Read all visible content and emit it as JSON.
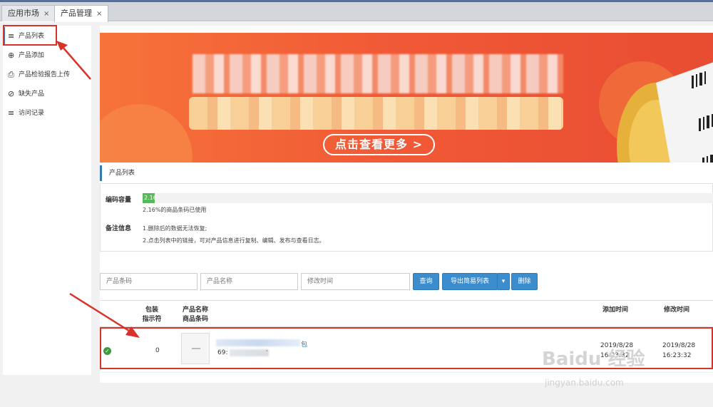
{
  "tabs": [
    {
      "label": "应用市场",
      "close": "×"
    },
    {
      "label": "产品管理",
      "close": "×"
    }
  ],
  "sidebar": {
    "items": [
      {
        "icon": "list-icon",
        "glyph": "≡",
        "label": "产品列表"
      },
      {
        "icon": "add-doc-icon",
        "glyph": "⊕",
        "label": "产品添加"
      },
      {
        "icon": "upload-doc-icon",
        "glyph": "⎙",
        "label": "产品检验报告上传"
      },
      {
        "icon": "missing-doc-icon",
        "glyph": "⊘",
        "label": "缺失产品"
      },
      {
        "icon": "list-icon",
        "glyph": "≡",
        "label": "访问记录"
      }
    ]
  },
  "banner": {
    "more_label": "点击查看更多 >"
  },
  "panel": {
    "title": "产品列表"
  },
  "info": {
    "capacity_label": "编码容量",
    "capacity_value": "2.16",
    "capacity_percent": 2.16,
    "capacity_note": "2.16%的商品条码已使用",
    "remark_label": "备注信息",
    "remark_1": "1.删除后的数据无法恢复;",
    "remark_2": "2.点击列表中的链接，可对产品信息进行复制、编辑、发布与查看日志。"
  },
  "filters": {
    "barcode_placeholder": "产品条码",
    "name_placeholder": "产品名称",
    "time_placeholder": "修改时间",
    "query_label": "查询",
    "export_label": "导出简易列表",
    "export_caret": "▾",
    "delete_label": "删除"
  },
  "table": {
    "headers": {
      "pack_1": "包装",
      "pack_2": "指示符",
      "name_1": "产品名称",
      "name_2": "商品条码",
      "added": "添加时间",
      "modified": "修改时间"
    },
    "rows": [
      {
        "indicator": "0",
        "name_suffix": "包",
        "barcode_prefix": "69:",
        "barcode_suffix": "·",
        "added_date": "2019/8/28",
        "added_time": "16:23:32",
        "modified_date": "2019/8/28",
        "modified_time": "16:23:32"
      }
    ]
  },
  "watermark": {
    "main": "Baidu 经验",
    "sub": "jingyan.baidu.com"
  },
  "colors": {
    "accent": "#337ab7",
    "button": "#3c8dce",
    "highlight": "#d9322a",
    "progress": "#5cb85c",
    "banner": "#f15a36"
  }
}
